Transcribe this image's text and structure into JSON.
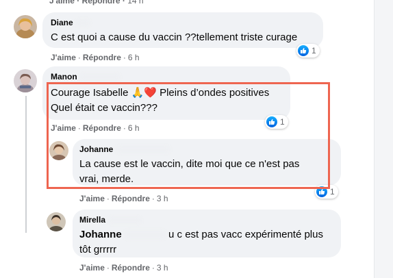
{
  "top_partial": {
    "actions": [
      "J'aime",
      "Répondre"
    ],
    "time": "14 h"
  },
  "comments": [
    {
      "author": "Diane",
      "text_lines": [
        "C est quoi a cause du vaccin ??tellement triste curage"
      ],
      "like": "J'aime",
      "reply": "Répondre",
      "time": "6 h",
      "reactions": "1"
    },
    {
      "author": "Manon",
      "text_lines": [
        "Courage Isabelle 🙏❤️ Pleins d’ondes positives",
        "Quel était ce vaccin???"
      ],
      "like": "J'aime",
      "reply": "Répondre",
      "time": "6 h",
      "reactions": "1"
    },
    {
      "author": "Johanne",
      "text_lines": [
        "La cause est le vaccin, dite moi que ce n'est pas",
        "vrai, merde."
      ],
      "like": "J'aime",
      "reply": "Répondre",
      "time": "3 h",
      "reactions": "1"
    },
    {
      "author": "Mirella",
      "mention": "Johanne",
      "text_line1_after": "u c est pas vacc expérimenté plus",
      "text_line2": "tôt grrrrr",
      "like": "J'aime",
      "reply": "Répondre",
      "time": "3 h"
    }
  ],
  "colors": {
    "highlight": "#ee6550",
    "bubble": "#f0f2f5",
    "like_blue": "#1877f2",
    "meta": "#65676b"
  }
}
